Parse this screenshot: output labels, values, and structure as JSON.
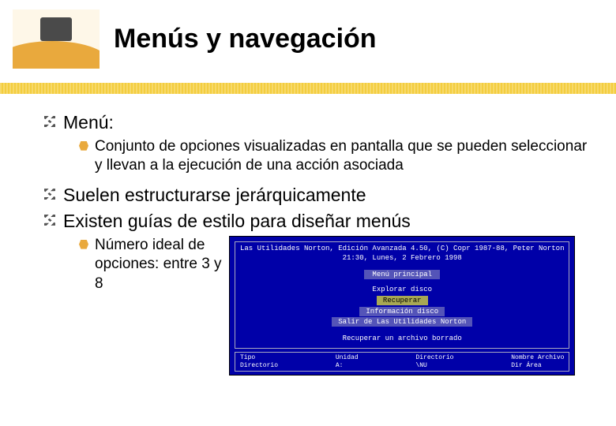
{
  "title": "Menús y navegación",
  "bullets": {
    "b1": "Menú:",
    "b1sub": "Conjunto de opciones visualizadas en pantalla que se pueden seleccionar y llevan a la ejecución de una acción asociada",
    "b2": "Suelen estructurarse jerárquicamente",
    "b3": "Existen guías de estilo para diseñar menús",
    "b3sub": "Número ideal de opciones: entre 3 y 8"
  },
  "dos": {
    "header": "Las Utilidades Norton, Edición Avanzada 4.50, (C) Copr 1987-88, Peter Norton",
    "date": "21:30, Lunes, 2 Febrero 1998",
    "menu_title": "Menú principal",
    "items": {
      "explore": "Explorar disco",
      "recover": "Recuperar",
      "info": "Información disco",
      "exit": "Salir de Las Utilidades Norton"
    },
    "footer_desc": "Recuperar un archivo borrado",
    "status": {
      "c1": "Tipo\nDirectorio",
      "c2": "Unidad\nA:",
      "c3": "Directorio\n\\NU",
      "c4": "Nombre Archivo\nDir Área"
    }
  }
}
